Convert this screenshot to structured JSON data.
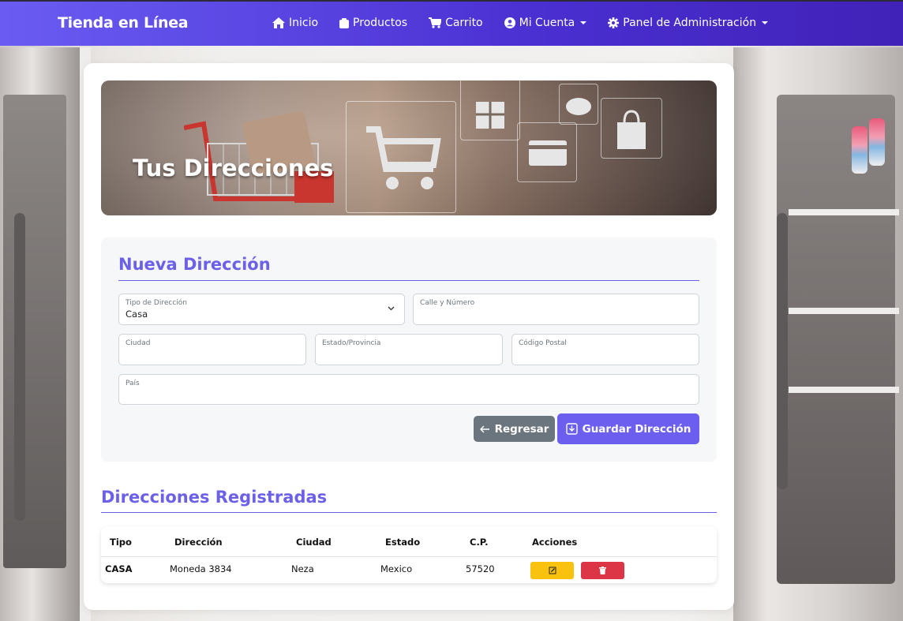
{
  "navbar": {
    "brand": "Tienda en Línea",
    "items": [
      {
        "label": "Inicio",
        "icon": "home-icon"
      },
      {
        "label": "Productos",
        "icon": "box-icon"
      },
      {
        "label": "Carrito",
        "icon": "cart-icon"
      },
      {
        "label": "Mi Cuenta",
        "icon": "user-circle-icon",
        "dropdown": true
      },
      {
        "label": "Panel de Administración",
        "icon": "gear-icon",
        "dropdown": true
      }
    ]
  },
  "hero": {
    "title": "Tus Direcciones"
  },
  "form": {
    "title": "Nueva Dirección",
    "tipo": {
      "label": "Tipo de Dirección",
      "value": "Casa"
    },
    "calle": {
      "label": "Calle y Número",
      "value": ""
    },
    "ciudad": {
      "label": "Ciudad",
      "value": ""
    },
    "estado": {
      "label": "Estado/Provincia",
      "value": ""
    },
    "cp": {
      "label": "Código Postal",
      "value": ""
    },
    "pais": {
      "label": "País",
      "value": ""
    },
    "back_button": "Regresar",
    "save_button": "Guardar Dirección"
  },
  "list": {
    "title": "Direcciones Registradas",
    "headers": [
      "Tipo",
      "Dirección",
      "Ciudad",
      "Estado",
      "C.P.",
      "Acciones"
    ],
    "rows": [
      {
        "tipo": "CASA",
        "direccion": "Moneda 3834",
        "ciudad": "Neza",
        "estado": "Mexico",
        "cp": "57520"
      }
    ]
  },
  "colors": {
    "accent": "#6c5fe8",
    "navbar_start": "#6a5cf3",
    "navbar_end": "#4122b8",
    "edit": "#f8c20f",
    "delete": "#dc3545",
    "back": "#6b757d"
  }
}
